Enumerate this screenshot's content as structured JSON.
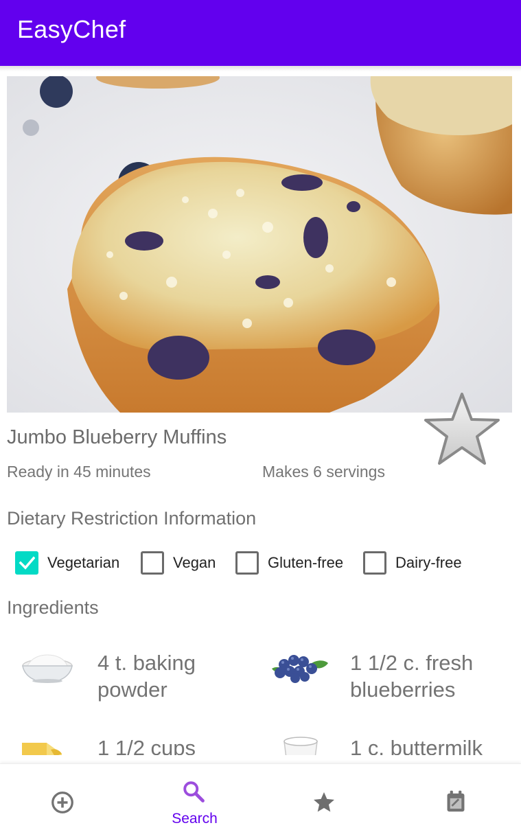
{
  "app_bar": {
    "title": "EasyChef"
  },
  "recipe": {
    "title": "Jumbo Blueberry Muffins",
    "ready": "Ready in 45 minutes",
    "servings": "Makes 6 servings",
    "image_icon": "blueberry-muffin-photo",
    "favorite_icon": "star-outline-icon"
  },
  "dietary": {
    "heading": "Dietary Restriction Information",
    "options": [
      {
        "label": "Vegetarian",
        "checked": true
      },
      {
        "label": "Vegan",
        "checked": false
      },
      {
        "label": "Gluten-free",
        "checked": false
      },
      {
        "label": "Dairy-free",
        "checked": false
      }
    ]
  },
  "ingredients": {
    "heading": "Ingredients",
    "items": [
      {
        "name": "4 t. baking powder",
        "line1": "4 t. baking",
        "line2": "powder",
        "icon": "baking-powder-bowl"
      },
      {
        "name": "1 1/2 c. fresh blueberries",
        "line1": "1 1/2 c. fresh",
        "line2": "blueberries",
        "icon": "blueberries"
      },
      {
        "name": "1 1/2 cups",
        "line1": "1 1/2 cups",
        "line2": "",
        "icon": "butter"
      },
      {
        "name": "1 c. buttermilk",
        "line1": "1 c. buttermilk",
        "line2": "",
        "icon": "buttermilk-cup"
      }
    ]
  },
  "bottom_nav": {
    "items": [
      {
        "label": "",
        "icon": "add-circle-icon",
        "active": false
      },
      {
        "label": "Search",
        "icon": "search-icon",
        "active": true
      },
      {
        "label": "",
        "icon": "star-icon",
        "active": false
      },
      {
        "label": "",
        "icon": "calendar-icon",
        "active": false
      }
    ]
  },
  "colors": {
    "primary": "#6200ee",
    "secondary": "#03dac5",
    "inactive_icon": "#737373"
  }
}
